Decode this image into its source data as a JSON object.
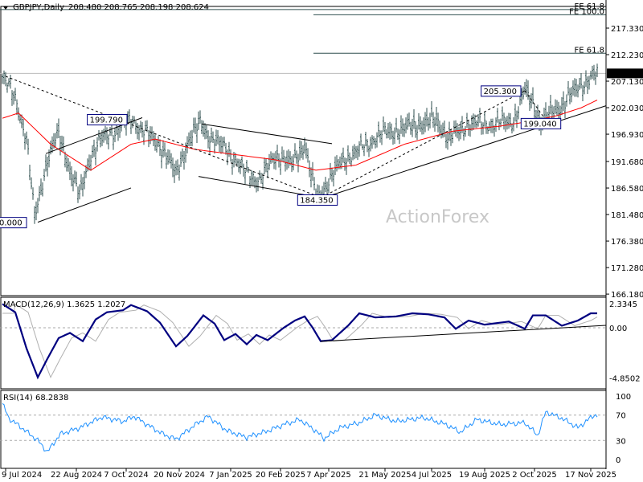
{
  "header": {
    "symbol": "GBPJPY,Daily",
    "ohlc": "208.480 208.765 208.198 208.624"
  },
  "watermark": "ActionForex",
  "colors": {
    "bars": "#2f4f4f",
    "ma": "#ff0000",
    "macd": "#000080",
    "signal": "#b0b0b0",
    "rsi": "#1e90ff",
    "fib": "#2f4f4f"
  },
  "chart_data": [
    {
      "type": "ohlc",
      "title": "GBPJPY,Daily",
      "price_ticks": [
        "217.330",
        "212.230",
        "207.130",
        "202.030",
        "196.930",
        "191.680",
        "186.580",
        "181.480",
        "176.380",
        "171.280",
        "166.180"
      ],
      "price_tick_values": [
        217.33,
        212.23,
        207.13,
        202.03,
        196.93,
        191.68,
        186.58,
        181.48,
        176.38,
        171.28,
        166.18
      ],
      "ylim": [
        166.18,
        217.33
      ],
      "current_price": "208.624",
      "close_keypoints": [
        [
          0,
          208
        ],
        [
          8,
          204
        ],
        [
          15,
          196
        ],
        [
          20,
          181
        ],
        [
          28,
          192
        ],
        [
          35,
          197
        ],
        [
          42,
          190
        ],
        [
          48,
          185
        ],
        [
          55,
          193
        ],
        [
          62,
          196
        ],
        [
          72,
          198
        ],
        [
          80,
          199.8
        ],
        [
          90,
          197
        ],
        [
          100,
          194
        ],
        [
          108,
          189
        ],
        [
          115,
          195
        ],
        [
          123,
          199
        ],
        [
          130,
          196
        ],
        [
          140,
          194
        ],
        [
          150,
          190
        ],
        [
          160,
          188
        ],
        [
          170,
          193
        ],
        [
          180,
          191
        ],
        [
          188,
          195
        ],
        [
          192,
          189
        ],
        [
          196,
          184.35
        ],
        [
          205,
          189
        ],
        [
          212,
          192
        ],
        [
          222,
          194
        ],
        [
          235,
          197
        ],
        [
          250,
          198
        ],
        [
          262,
          199
        ],
        [
          270,
          199.5
        ],
        [
          278,
          196
        ],
        [
          290,
          199
        ],
        [
          305,
          199
        ],
        [
          318,
          199.5
        ],
        [
          325,
          205.3
        ],
        [
          330,
          203
        ],
        [
          335,
          199.04
        ],
        [
          342,
          201
        ],
        [
          350,
          203
        ],
        [
          358,
          206
        ],
        [
          365,
          207.5
        ],
        [
          370,
          208.6
        ]
      ],
      "ma_keypoints": [
        [
          0,
          200
        ],
        [
          10,
          201
        ],
        [
          30,
          195
        ],
        [
          55,
          190
        ],
        [
          80,
          195
        ],
        [
          95,
          196
        ],
        [
          120,
          194
        ],
        [
          145,
          193
        ],
        [
          170,
          192
        ],
        [
          195,
          190
        ],
        [
          220,
          191
        ],
        [
          250,
          195
        ],
        [
          280,
          197.5
        ],
        [
          310,
          198.5
        ],
        [
          330,
          199.5
        ],
        [
          345,
          200.5
        ],
        [
          360,
          202
        ],
        [
          370,
          203.5
        ]
      ],
      "annotations": [
        {
          "label": "199.790",
          "bar": 80,
          "price": 199.79
        },
        {
          "label": "184.350",
          "bar": 196,
          "price": 184.35
        },
        {
          "label": "205.300",
          "bar": 325,
          "price": 205.3
        },
        {
          "label": "199.040",
          "bar": 335,
          "price": 199.04
        },
        {
          "label": "0.000",
          "bar": 20,
          "price": 180.0
        }
      ],
      "fib_levels": [
        {
          "label": "FE 61.8",
          "price": 220.9
        },
        {
          "label": "FE 100.0",
          "price": 219.9
        },
        {
          "label": "FE 61.8",
          "price": 212.5
        }
      ],
      "trendlines": [
        {
          "style": "dashed",
          "from": [
            2,
            208.06
          ],
          "to": [
            197,
            184.89
          ]
        },
        {
          "style": "solid",
          "from": [
            27,
            193.2
          ],
          "to": [
            87,
            200.1
          ]
        },
        {
          "style": "solid",
          "from": [
            22,
            180.0
          ],
          "to": [
            80,
            186.6
          ]
        },
        {
          "style": "solid",
          "from": [
            124,
            198.9
          ],
          "to": [
            205,
            195.1
          ]
        },
        {
          "style": "solid",
          "from": [
            122,
            188.8
          ],
          "to": [
            195,
            184.9
          ]
        },
        {
          "style": "solid",
          "from": [
            196,
            184.35
          ],
          "to": [
            400,
            202.4
          ]
        },
        {
          "style": "dashed",
          "from": [
            196,
            184.35
          ],
          "to": [
            325,
            205.3
          ]
        },
        {
          "style": "dashed",
          "from": [
            325,
            205.3
          ],
          "to": [
            340,
            198.8
          ]
        }
      ],
      "dates": [
        [
          "9 Jul 2024",
          2
        ],
        [
          "22 Aug 2024",
          46
        ],
        [
          "7 Oct 2024",
          77
        ],
        [
          "20 Nov 2024",
          110
        ],
        [
          "7 Jan 2025",
          142
        ],
        [
          "20 Feb 2025",
          173
        ],
        [
          "7 Apr 2025",
          203
        ],
        [
          "21 May 2025",
          238
        ],
        [
          "4 Jul 2025",
          267
        ],
        [
          "19 Aug 2025",
          300
        ],
        [
          "2 Oct 2025",
          331
        ],
        [
          "17 Nov 2025",
          366
        ]
      ]
    },
    {
      "type": "line",
      "title": "MACD(12,26,9) 1.3625 1.2027",
      "ticks": [
        "2.3345",
        "0.00",
        "-4.8502"
      ],
      "tick_values": [
        2.3345,
        0,
        -4.8502
      ],
      "macd_keypoints": [
        [
          0,
          2.3
        ],
        [
          8,
          1.5
        ],
        [
          15,
          -2
        ],
        [
          22,
          -4.8
        ],
        [
          28,
          -3
        ],
        [
          35,
          -1
        ],
        [
          42,
          -0.5
        ],
        [
          50,
          -1.3
        ],
        [
          58,
          0.8
        ],
        [
          65,
          1.5
        ],
        [
          75,
          1.7
        ],
        [
          80,
          2.2
        ],
        [
          90,
          1.6
        ],
        [
          98,
          0.5
        ],
        [
          108,
          -1.8
        ],
        [
          115,
          -0.8
        ],
        [
          125,
          1.2
        ],
        [
          132,
          0.4
        ],
        [
          138,
          -1.2
        ],
        [
          145,
          -0.6
        ],
        [
          152,
          -1.6
        ],
        [
          158,
          -0.7
        ],
        [
          165,
          -1.2
        ],
        [
          175,
          0
        ],
        [
          182,
          0.7
        ],
        [
          188,
          1.1
        ],
        [
          193,
          0
        ],
        [
          198,
          -1.3
        ],
        [
          205,
          -1.2
        ],
        [
          215,
          0.2
        ],
        [
          222,
          1.4
        ],
        [
          232,
          1
        ],
        [
          245,
          1.1
        ],
        [
          255,
          1.4
        ],
        [
          265,
          1.3
        ],
        [
          275,
          1
        ],
        [
          282,
          -0.1
        ],
        [
          290,
          0.7
        ],
        [
          300,
          0.3
        ],
        [
          315,
          0.6
        ],
        [
          325,
          -0.1
        ],
        [
          330,
          1.2
        ],
        [
          338,
          1.2
        ],
        [
          348,
          0.2
        ],
        [
          358,
          0.7
        ],
        [
          366,
          1.4
        ],
        [
          372,
          1.4
        ]
      ],
      "signal_lag": 4,
      "trendline": {
        "from": [
          198,
          -1.32
        ],
        "to": [
          378,
          0.23
        ]
      }
    },
    {
      "type": "line",
      "title": "RSI(14) 68.2838",
      "ticks": [
        "100",
        "70",
        "30",
        "0"
      ],
      "tick_values": [
        100,
        70,
        30,
        0
      ],
      "levels": [
        70,
        30
      ],
      "rsi_keypoints": [
        [
          0,
          88
        ],
        [
          4,
          65
        ],
        [
          12,
          50
        ],
        [
          22,
          30
        ],
        [
          28,
          12
        ],
        [
          36,
          40
        ],
        [
          48,
          50
        ],
        [
          62,
          67
        ],
        [
          75,
          60
        ],
        [
          82,
          68
        ],
        [
          90,
          55
        ],
        [
          100,
          40
        ],
        [
          108,
          32
        ],
        [
          120,
          55
        ],
        [
          128,
          68
        ],
        [
          140,
          45
        ],
        [
          152,
          35
        ],
        [
          165,
          45
        ],
        [
          175,
          55
        ],
        [
          185,
          63
        ],
        [
          195,
          45
        ],
        [
          200,
          33
        ],
        [
          210,
          50
        ],
        [
          222,
          58
        ],
        [
          232,
          70
        ],
        [
          245,
          60
        ],
        [
          262,
          66
        ],
        [
          276,
          55
        ],
        [
          285,
          43
        ],
        [
          295,
          63
        ],
        [
          310,
          55
        ],
        [
          325,
          58
        ],
        [
          333,
          38
        ],
        [
          338,
          75
        ],
        [
          348,
          65
        ],
        [
          358,
          50
        ],
        [
          368,
          70
        ],
        [
          375,
          68
        ]
      ]
    }
  ]
}
